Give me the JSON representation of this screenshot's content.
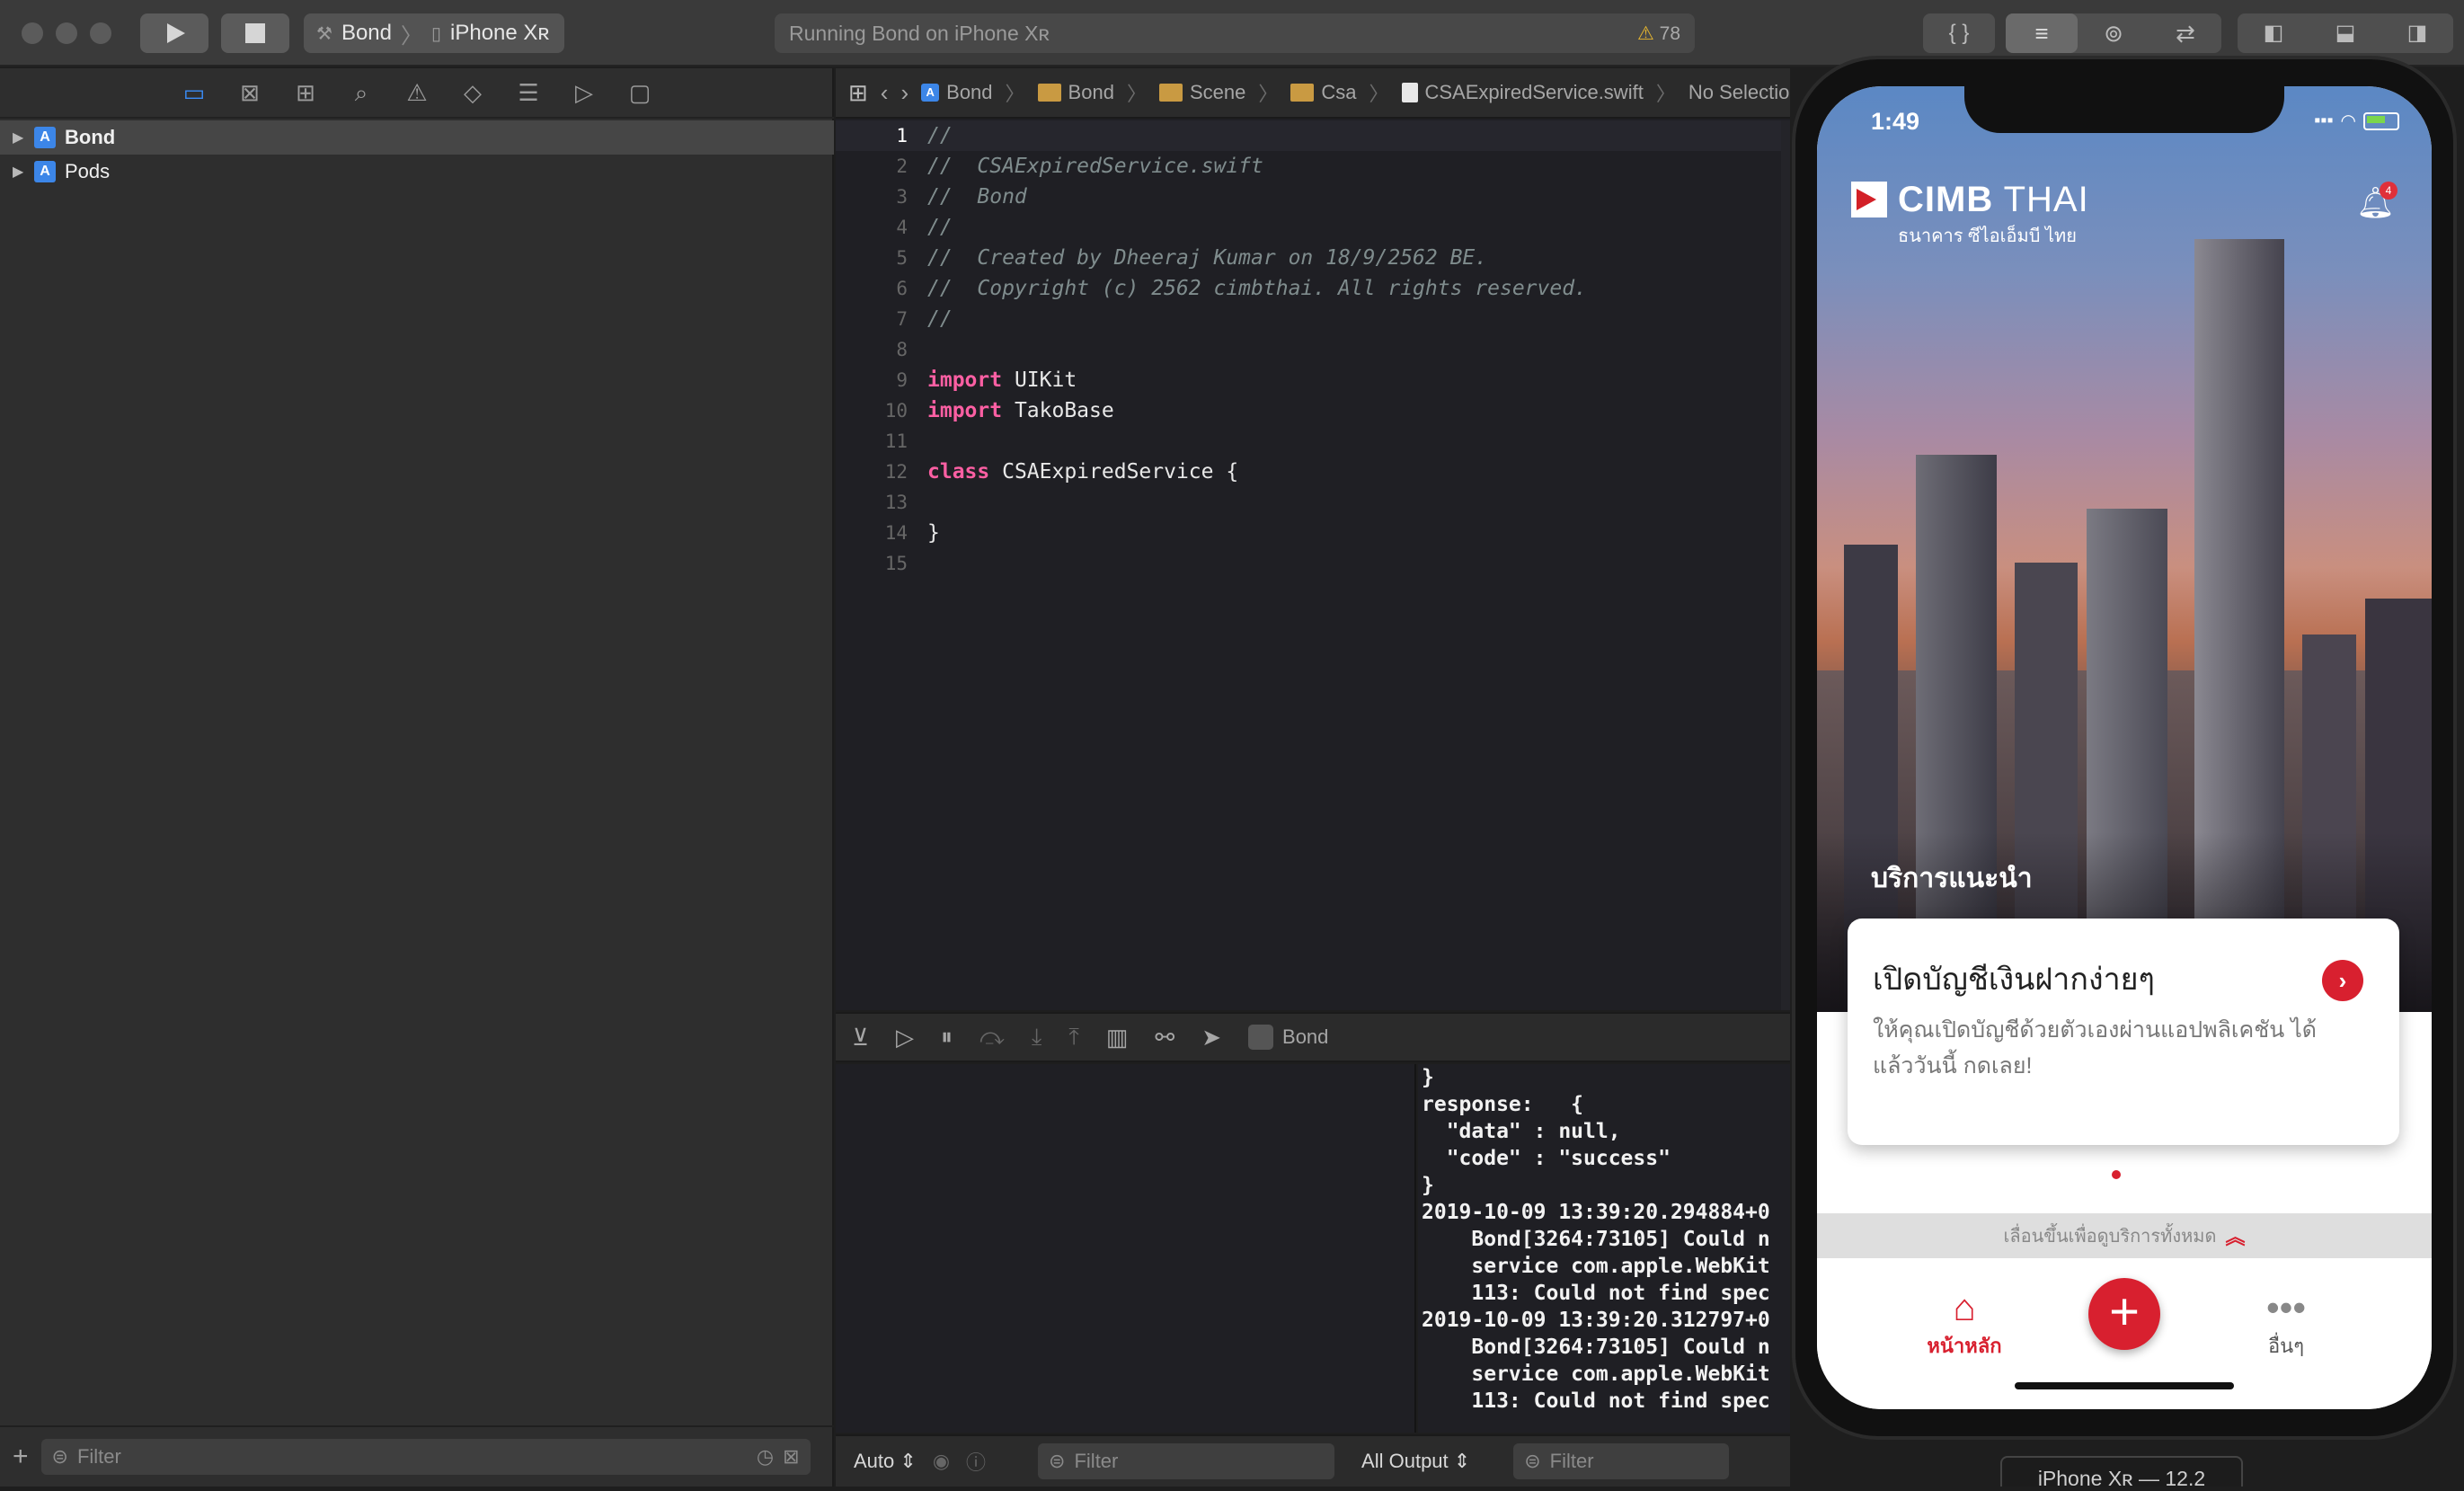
{
  "toolbar": {
    "scheme_name": "Bond",
    "destination": "iPhone Xʀ",
    "activity_text": "Running Bond on iPhone Xʀ",
    "warning_count": "78"
  },
  "navigator": {
    "items": [
      {
        "label": "Bond"
      },
      {
        "label": "Pods"
      }
    ],
    "filter_placeholder": "Filter"
  },
  "editor": {
    "breadcrumb": [
      "Bond",
      "Bond",
      "Scene",
      "Csa",
      "CSAExpiredService.swift",
      "No Selection"
    ],
    "line_numbers": [
      "1",
      "2",
      "3",
      "4",
      "5",
      "6",
      "7",
      "8",
      "9",
      "10",
      "11",
      "12",
      "13",
      "14",
      "15"
    ],
    "lines": [
      {
        "kind": "cmt",
        "text": "//"
      },
      {
        "kind": "cmt",
        "text": "//  CSAExpiredService.swift"
      },
      {
        "kind": "cmt",
        "text": "//  Bond"
      },
      {
        "kind": "cmt",
        "text": "//"
      },
      {
        "kind": "cmt",
        "text": "//  Created by Dheeraj Kumar on 18/9/2562 BE."
      },
      {
        "kind": "cmt",
        "text": "//  Copyright (c) 2562 cimbthai. All rights reserved."
      },
      {
        "kind": "cmt",
        "text": "//"
      },
      {
        "kind": "plain",
        "text": ""
      },
      {
        "kind": "kw",
        "kw": "import",
        "text": " UIKit"
      },
      {
        "kind": "kw",
        "kw": "import",
        "text": " TakoBase"
      },
      {
        "kind": "plain",
        "text": ""
      },
      {
        "kind": "kw",
        "kw": "class",
        "text": " CSAExpiredService {"
      },
      {
        "kind": "plain",
        "text": ""
      },
      {
        "kind": "plain",
        "text": "}"
      },
      {
        "kind": "plain",
        "text": ""
      }
    ]
  },
  "debug": {
    "process_name": "Bond",
    "console_output": "}\nresponse:   {\n  \"data\" : null,\n  \"code\" : \"success\"\n}\n2019-10-09 13:39:20.294884+0\n    Bond[3264:73105] Could n\n    service com.apple.WebKit\n    113: Could not find spec\n2019-10-09 13:39:20.312797+0\n    Bond[3264:73105] Could n\n    service com.apple.WebKit\n    113: Could not find spec",
    "variables_mode": "Auto",
    "variables_filter_placeholder": "Filter",
    "output_mode": "All Output",
    "console_filter_placeholder": "Filter"
  },
  "simulator": {
    "window_title": "iPhone Xʀ — 12.2",
    "status_time": "1:49",
    "brand_name_bold": "CIMB",
    "brand_name_light": " THAI",
    "brand_subtitle": "ธนาคาร ซีไอเอ็มบี ไทย",
    "notification_count": "4",
    "section_title": "บริการแนะนำ",
    "card_title": "เปิดบัญชีเงินฝากง่ายๆ",
    "card_description": "ให้คุณเปิดบัญชีด้วยตัวเองผ่านแอปพลิเคชัน ได้แล้ววันนี้ กดเลย!",
    "swipe_hint": "เลื่อนขึ้นเพื่อดูบริการทั้งหมด",
    "tabs": [
      {
        "label": "หน้าหลัก",
        "icon": "home-icon"
      },
      {
        "label": "อื่นๆ",
        "icon": "more-icon"
      }
    ],
    "carousel_page": "1 of 2"
  },
  "colors": {
    "accent_blue": "#3a8cf7",
    "keyword_pink": "#fc5fa3",
    "cimb_red": "#d8202f"
  }
}
